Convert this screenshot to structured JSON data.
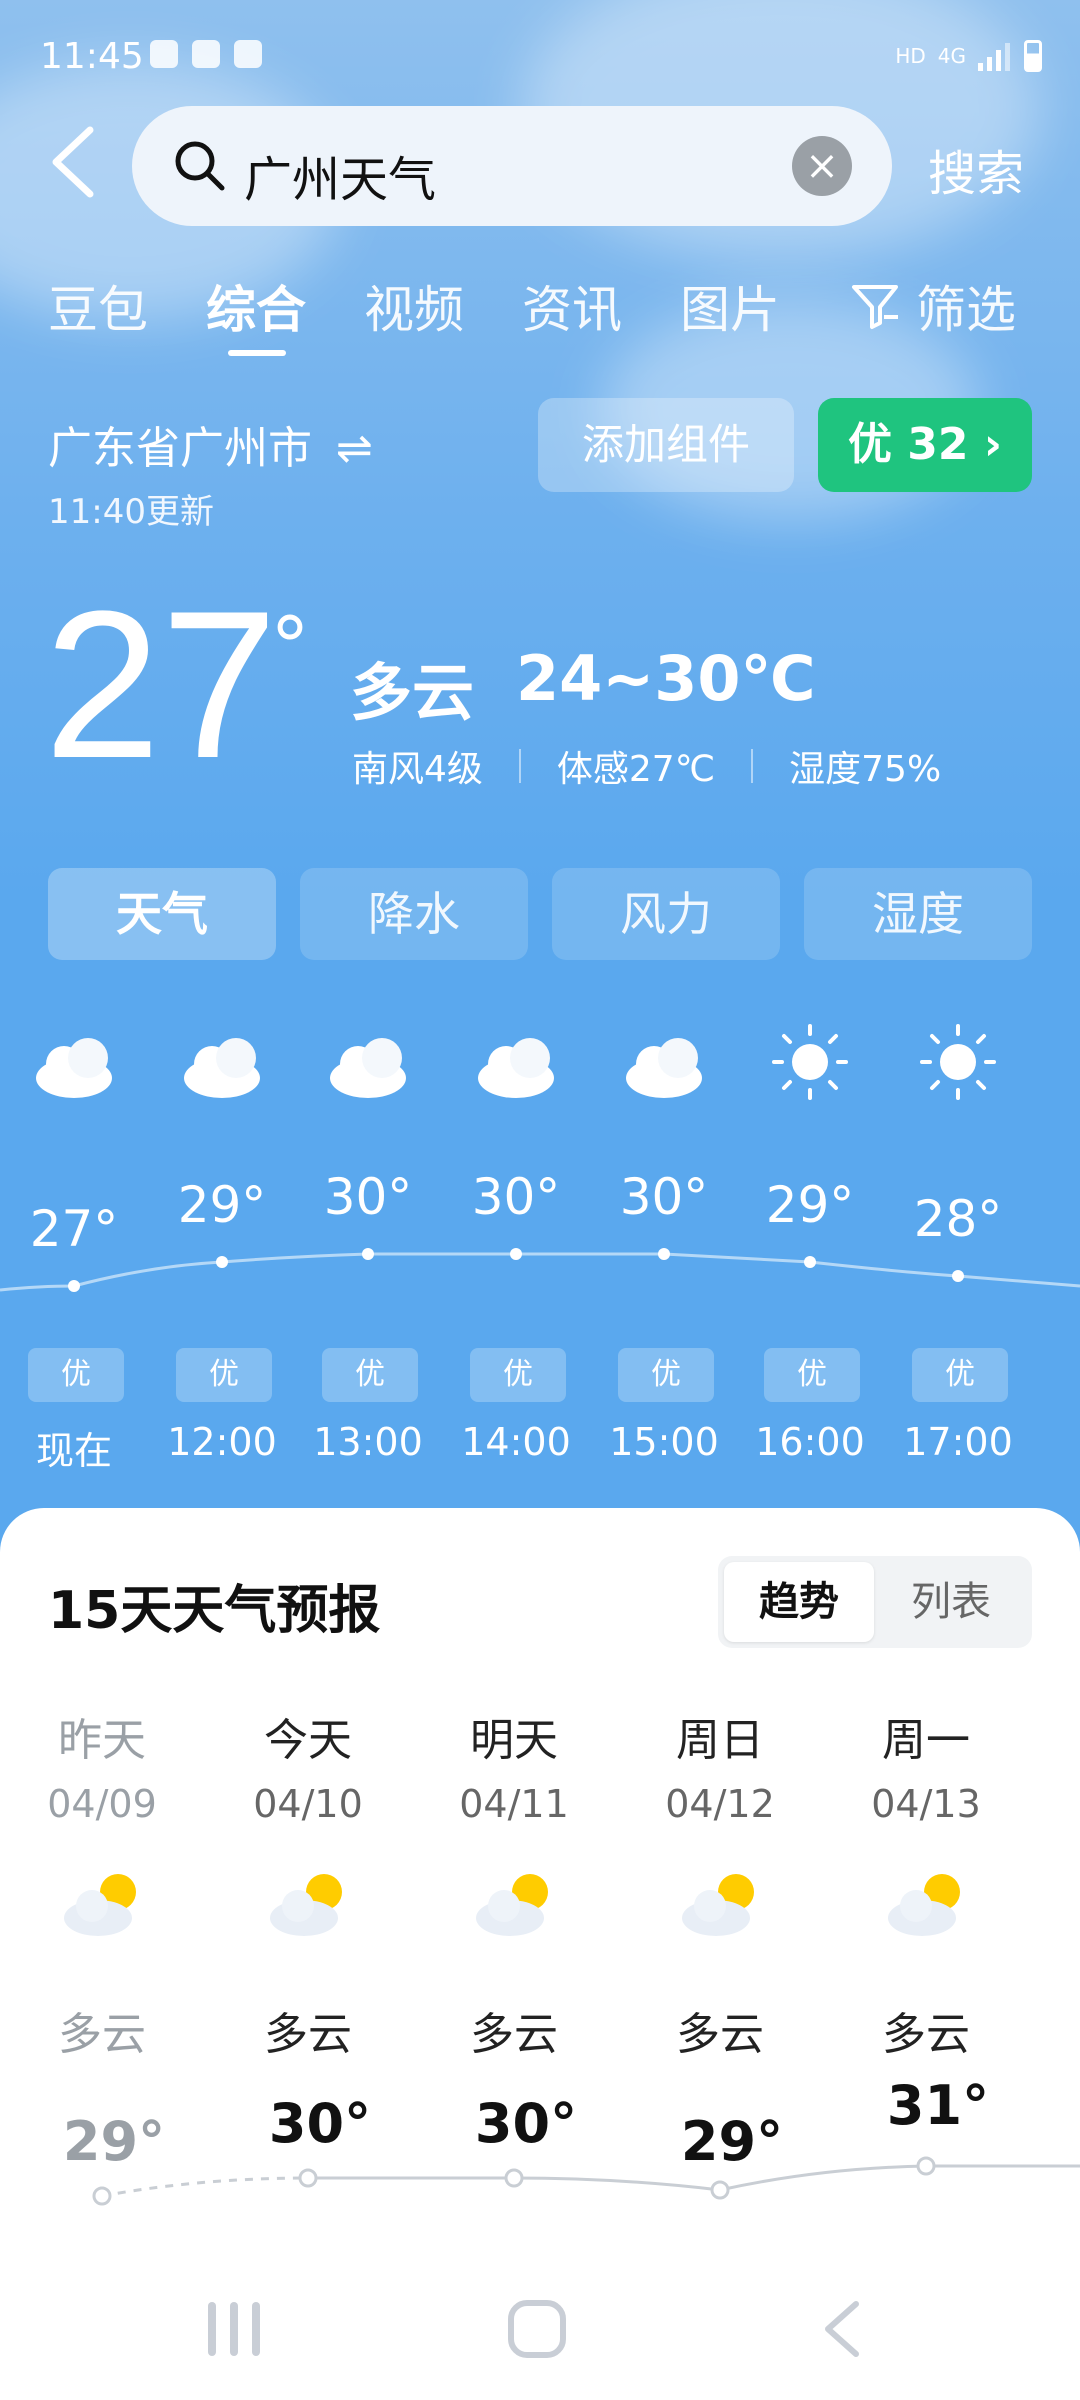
{
  "status": {
    "time": "11:45",
    "net": "HD",
    "signal": "4G"
  },
  "search": {
    "query": "广州天气",
    "button": "搜索"
  },
  "tabs": [
    {
      "label": "豆包"
    },
    {
      "label": "综合"
    },
    {
      "label": "视频"
    },
    {
      "label": "资讯"
    },
    {
      "label": "图片"
    },
    {
      "label": "筛选"
    }
  ],
  "location": {
    "name": "广东省广州市",
    "updated": "11:40更新",
    "add_widget": "添加组件",
    "aqi": "优 32"
  },
  "current": {
    "temp": "27",
    "degree": "°",
    "condition": "多云",
    "range": "24~30℃",
    "wind": "南风4级",
    "feels": "体感27℃",
    "humidity": "湿度75%"
  },
  "chips": [
    {
      "label": "天气"
    },
    {
      "label": "降水"
    },
    {
      "label": "风力"
    },
    {
      "label": "湿度"
    }
  ],
  "hourly": [
    {
      "temp": "27°",
      "aqi": "优",
      "time": "现在",
      "icon": "cloud-icon"
    },
    {
      "temp": "29°",
      "aqi": "优",
      "time": "12:00",
      "icon": "cloud-icon"
    },
    {
      "temp": "30°",
      "aqi": "优",
      "time": "13:00",
      "icon": "cloud-icon"
    },
    {
      "temp": "30°",
      "aqi": "优",
      "time": "14:00",
      "icon": "cloud-icon"
    },
    {
      "temp": "30°",
      "aqi": "优",
      "time": "15:00",
      "icon": "cloud-icon"
    },
    {
      "temp": "29°",
      "aqi": "优",
      "time": "16:00",
      "icon": "sun-icon"
    },
    {
      "temp": "28°",
      "aqi": "优",
      "time": "17:00",
      "icon": "sun-icon"
    }
  ],
  "forecast": {
    "title": "15天天气预报",
    "toggle": {
      "trend": "趋势",
      "list": "列表"
    },
    "days": [
      {
        "day": "昨天",
        "date": "04/09",
        "cond": "多云",
        "temp": "29°"
      },
      {
        "day": "今天",
        "date": "04/10",
        "cond": "多云",
        "temp": "30°"
      },
      {
        "day": "明天",
        "date": "04/11",
        "cond": "多云",
        "temp": "30°"
      },
      {
        "day": "周日",
        "date": "04/12",
        "cond": "多云",
        "temp": "29°"
      },
      {
        "day": "周一",
        "date": "04/13",
        "cond": "多云",
        "temp": "31°"
      }
    ]
  },
  "colors": {
    "aqi_good": "#1fc47f",
    "sky": "#5aa8ee"
  }
}
